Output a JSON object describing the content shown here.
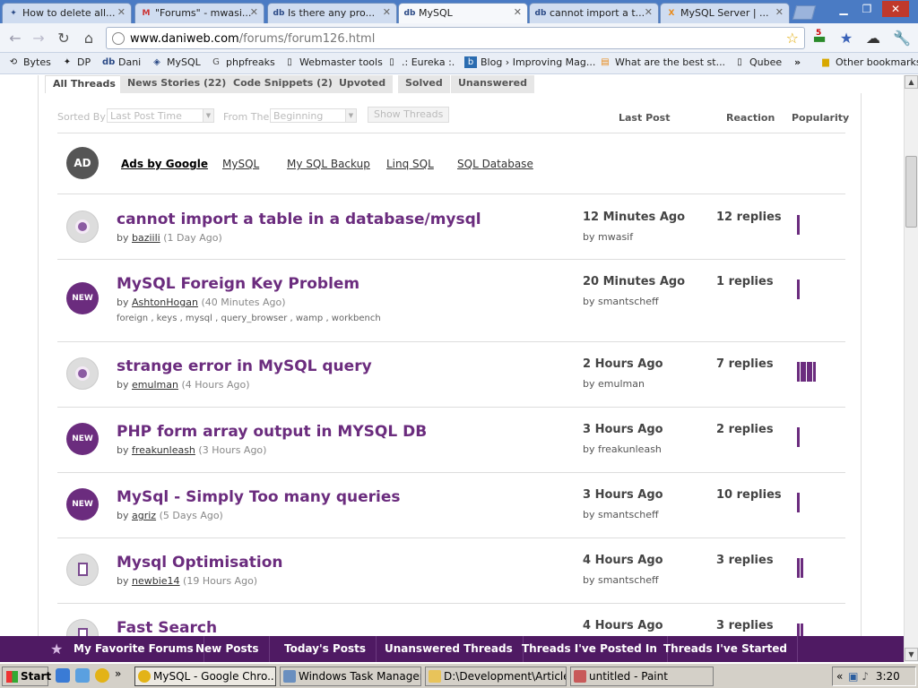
{
  "browser": {
    "tabs": [
      {
        "label": "How to delete all...",
        "icon": "dp-icon"
      },
      {
        "label": "\"Forums\" - mwasi...",
        "icon": "gmail-icon"
      },
      {
        "label": "Is there any pro...",
        "icon": "db-icon"
      },
      {
        "label": "MySQL",
        "icon": "db-icon"
      },
      {
        "label": "cannot import a t...",
        "icon": "db-icon"
      },
      {
        "label": "MySQL Server | ...",
        "icon": "x-icon"
      }
    ],
    "url_host": "www.daniweb.com",
    "url_path": "/forums/forum126.html",
    "badge_count": "5"
  },
  "bookmarks": [
    {
      "label": "Bytes",
      "icon": "bytes-icon"
    },
    {
      "label": "DP",
      "icon": "dp-icon"
    },
    {
      "label": "Dani",
      "icon": "db-icon"
    },
    {
      "label": "MySQL",
      "icon": "mysql-icon"
    },
    {
      "label": "phpfreaks",
      "icon": "phpfreaks-icon"
    },
    {
      "label": "Webmaster tools",
      "icon": "page-icon"
    },
    {
      "label": ".: Eureka :.",
      "icon": "page-icon"
    },
    {
      "label": "Blog › Improving Mag...",
      "icon": "blog-icon"
    },
    {
      "label": "What are the best st...",
      "icon": "so-icon"
    },
    {
      "label": "Qubee",
      "icon": "page-icon"
    }
  ],
  "other_bookmarks": "Other bookmarks",
  "content_tabs": [
    "All Threads",
    "News Stories (22)",
    "Code Snippets (2)",
    "Upvoted",
    "Solved",
    "Unanswered"
  ],
  "filters": {
    "sorted_by_label": "Sorted By",
    "sorted_by_value": "Last Post Time",
    "from_the_label": "From The",
    "from_the_value": "Beginning",
    "show_button": "Show Threads"
  },
  "columns": {
    "last_post": "Last Post",
    "reaction": "Reaction",
    "popularity": "Popularity"
  },
  "ads": {
    "badge": "AD",
    "links": [
      "Ads by Google",
      "MySQL",
      "My SQL Backup",
      "Linq SQL",
      "SQL Database"
    ]
  },
  "threads": [
    {
      "badge": "hot",
      "badge_label": "",
      "title": "cannot import a table in a database/mysql",
      "by_prefix": "by",
      "author": "baziili",
      "age": "(1 Day Ago)",
      "tags": "",
      "last_post": "12 Minutes Ago",
      "last_by": "by mwasif",
      "replies": "12 replies",
      "popularity": 1
    },
    {
      "badge": "new",
      "badge_label": "NEW",
      "title": "MySQL Foreign Key Problem",
      "by_prefix": "by",
      "author": "AshtonHogan",
      "age": "(40 Minutes Ago)",
      "tags": "foreign , keys , mysql , query_browser , wamp , workbench",
      "last_post": "20 Minutes Ago",
      "last_by": "by smantscheff",
      "replies": "1 replies",
      "popularity": 1
    },
    {
      "badge": "hot",
      "badge_label": "",
      "title": "strange error in MySQL query",
      "by_prefix": "by",
      "author": "emulman",
      "age": "(4 Hours Ago)",
      "tags": "",
      "last_post": "2 Hours Ago",
      "last_by": "by emulman",
      "replies": "7 replies",
      "popularity": 6
    },
    {
      "badge": "new",
      "badge_label": "NEW",
      "title": "PHP form array output in MYSQL DB",
      "by_prefix": "by",
      "author": "freakunleash",
      "age": "(3 Hours Ago)",
      "tags": "",
      "last_post": "3 Hours Ago",
      "last_by": "by freakunleash",
      "replies": "2 replies",
      "popularity": 1
    },
    {
      "badge": "new",
      "badge_label": "NEW",
      "title": "MySql - Simply Too many queries",
      "by_prefix": "by",
      "author": "agriz",
      "age": "(5 Days Ago)",
      "tags": "",
      "last_post": "3 Hours Ago",
      "last_by": "by smantscheff",
      "replies": "10 replies",
      "popularity": 1
    },
    {
      "badge": "doc",
      "badge_label": "",
      "title": "Mysql Optimisation",
      "by_prefix": "by",
      "author": "newbie14",
      "age": "(19 Hours Ago)",
      "tags": "",
      "last_post": "4 Hours Ago",
      "last_by": "by smantscheff",
      "replies": "3 replies",
      "popularity": 2
    },
    {
      "badge": "doc",
      "badge_label": "",
      "title": "Fast Search",
      "by_prefix": "",
      "author": "",
      "age": "",
      "tags": "",
      "last_post": "4 Hours Ago",
      "last_by": "",
      "replies": "3 replies",
      "popularity": 2
    }
  ],
  "fav_bar": [
    "My Favorite Forums",
    "New Posts",
    "Today's Posts",
    "Unanswered Threads",
    "Threads I've Posted In",
    "Threads I've Started"
  ],
  "taskbar": {
    "start": "Start",
    "items": [
      {
        "label": "MySQL - Google Chro...",
        "active": true
      },
      {
        "label": "Windows Task Manager",
        "active": false
      },
      {
        "label": "D:\\Development\\Articles...",
        "active": false
      },
      {
        "label": "untitled - Paint",
        "active": false
      }
    ],
    "clock": "3:20 AM"
  },
  "colors": {
    "brand_purple": "#6b2c7e",
    "fav_bar": "#4f1a63",
    "tab_bar": "#4a7bc4"
  }
}
